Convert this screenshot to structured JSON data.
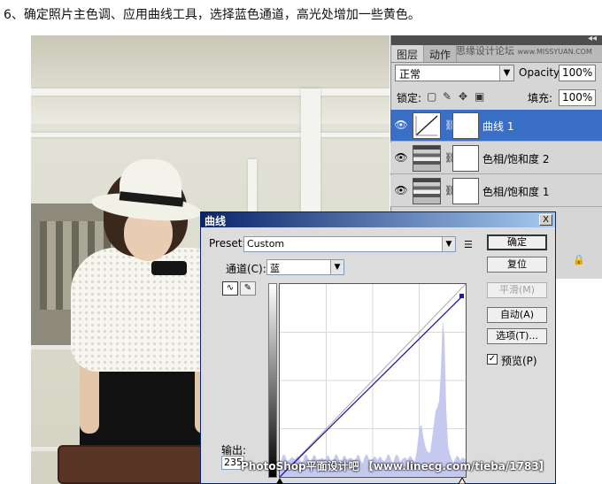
{
  "instruction": "6、确定照片主色调、应用曲线工具，选择蓝色通道，高光处增加一些黄色。",
  "layers_panel": {
    "tabs": [
      "图层",
      "动作"
    ],
    "watermark_top": "思缘设计论坛",
    "watermark_top_url": "www.MISSYUAN.COM",
    "blend_mode": "正常",
    "opacity_label": "Opacity:",
    "opacity_value": "100%",
    "lock_label": "锁定:",
    "fill_label": "填充:",
    "fill_value": "100%",
    "layers": [
      {
        "name": "曲线 1",
        "type": "curves",
        "selected": true
      },
      {
        "name": "色相/饱和度 2",
        "type": "hue-saturation",
        "selected": false
      },
      {
        "name": "色相/饱和度 1",
        "type": "hue-saturation",
        "selected": false
      }
    ]
  },
  "curves_dialog": {
    "title": "曲线",
    "close": "X",
    "preset_label": "Preset:",
    "preset_value": "Custom",
    "channel_label": "通道(C):",
    "channel_value": "蓝",
    "output_label": "输出:",
    "output_value": "235",
    "buttons": {
      "ok": "确定",
      "reset": "复位",
      "smooth": "平滑(M)",
      "auto": "自动(A)",
      "options": "选项(T)..."
    },
    "preview_label": "预览(P)",
    "preview_checked": "✓",
    "curve_color": "#1a1aa8",
    "histogram_color": "#c5c9f0"
  },
  "bottom_watermark": "PhotoShop平面设计吧 【www.linecg.com/tieba/1783】"
}
